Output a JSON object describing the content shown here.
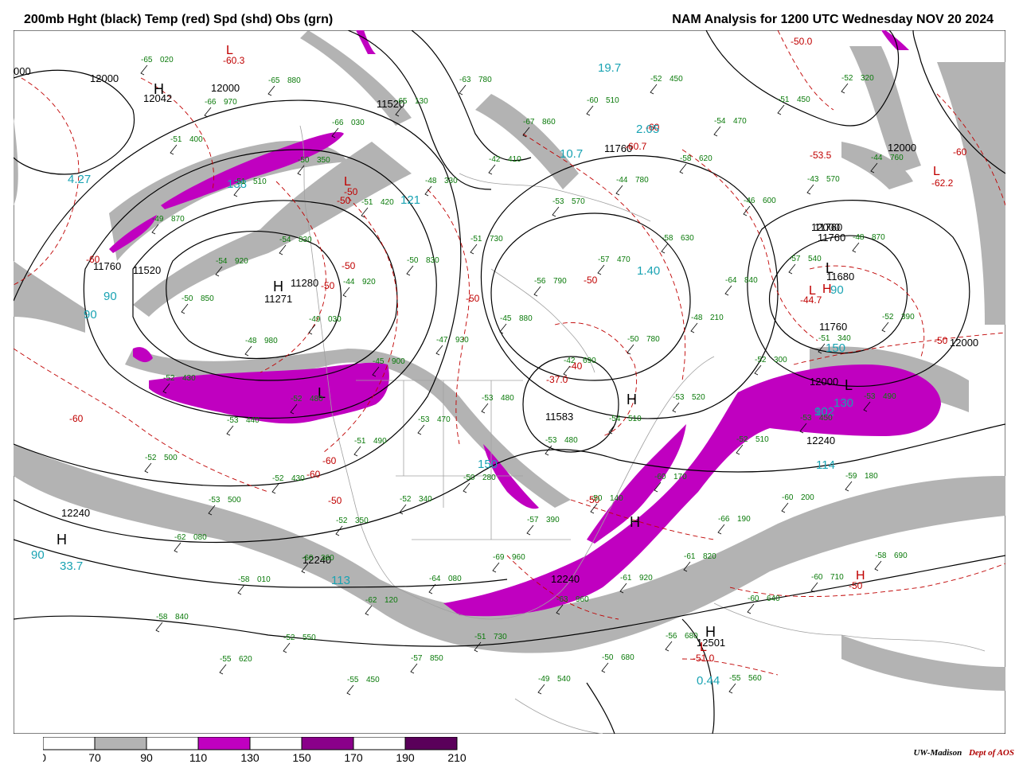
{
  "header": {
    "left_title": "200mb Hght (black) Temp (red) Spd (shd) Obs (grn)",
    "right_title": "NAM Analysis for 1200 UTC Wednesday  NOV 20 2024"
  },
  "colors": {
    "height": "#000000",
    "temp": "#c00000",
    "speed_label": "#19a3b3",
    "obs": "#0a7a0a",
    "geo": "#a0a0a0",
    "shade_70": "#b3b3b3",
    "shade_110": "#c000c0",
    "shade_150": "#8a008a",
    "shade_190": "#5a005a"
  },
  "legend": {
    "ticks": [
      "0",
      "70",
      "90",
      "110",
      "130",
      "150",
      "170",
      "190",
      "210"
    ],
    "colors": [
      "#ffffff",
      "#b3b3b3",
      "#ffffff",
      "#c000c0",
      "#ffffff",
      "#8a008a",
      "#ffffff",
      "#5a005a"
    ]
  },
  "credit": {
    "org": "UW-Madison",
    "dept": "Dept of AOS"
  },
  "height_labels": [
    "000",
    "12000",
    "12042",
    "12000",
    "11520",
    "12000",
    "11760",
    "11520",
    "11280",
    "11271",
    "11760",
    "12000",
    "11760",
    "11680",
    "11760",
    "12000",
    "12000",
    "12240",
    "11583",
    "11760",
    "12240",
    "12240",
    "12240",
    "12501"
  ],
  "height_centers": [
    "H",
    "H",
    "L",
    "L",
    "H",
    "L",
    "H",
    "H",
    "H"
  ],
  "temp_labels": [
    "-60.3",
    "-60",
    "-50",
    "-50",
    "-50",
    "-50",
    "-60.7",
    "-60",
    "-50",
    "-50.0",
    "-50",
    "-62.2",
    "-60",
    "-50",
    "-44.7",
    "-50",
    "-37.0",
    "-40",
    "-60",
    "-60",
    "-50",
    "-50",
    "-51.0",
    "-53.5",
    "-60"
  ],
  "temp_centers": [
    "L",
    "L",
    "L",
    "L",
    "H",
    "L",
    "H"
  ],
  "speed_labels": [
    "19.7",
    "4.27",
    "138",
    "121",
    "90",
    "90",
    "10.7",
    "2.05",
    "1.40",
    "90",
    "150",
    "130",
    "90",
    "114",
    "150",
    "102",
    "90",
    "33.7",
    "113",
    "0.44"
  ],
  "obs_labels": [
    "-65 020",
    "-66 970",
    "-65 880",
    "-66 030",
    "-65 130",
    "-63 780",
    "-67 860",
    "-60 510",
    "-52 450",
    "-54 470",
    "-51 450",
    "-52 320",
    "-51 400",
    "-51 510",
    "-50 350",
    "-51 420",
    "-48 330",
    "-42 410",
    "-53 570",
    "-44 780",
    "-58 620",
    "-46 600",
    "-43 570",
    "-44 760",
    "-49 870",
    "-54 920",
    "-54 830",
    "-44 920",
    "-50 830",
    "-51 730",
    "-56 790",
    "-57 470",
    "-58 630",
    "-64 840",
    "-57 540",
    "-48 870",
    "-50 850",
    "-48 980",
    "-49 030",
    "-45 900",
    "-47 930",
    "-45 880",
    "-42 690",
    "-50 780",
    "-48 210",
    "-52 300",
    "-51 340",
    "-52 390",
    "-52 430",
    "-53 440",
    "-52 480",
    "-51 490",
    "-53 470",
    "-53 480",
    "-53 480",
    "-54 510",
    "-53 520",
    "-52 510",
    "-53 450",
    "-53 490",
    "-52 500",
    "-53 500",
    "-52 430",
    "-52 350",
    "-52 340",
    "-50 280",
    "-57 390",
    "-50 140",
    "-60 170",
    "-66 190",
    "-60 200",
    "-59 180",
    "-62 080",
    "-58 010",
    "-60 360",
    "-62 120",
    "-64 080",
    "-69 960",
    "-63 960",
    "-61 920",
    "-61 820",
    "-60 640",
    "-60 710",
    "-58 690",
    "-58 840",
    "-55 620",
    "-52 550",
    "-55 450",
    "-57 850",
    "-51 730",
    "-49 540",
    "-50 680",
    "-56 680",
    "-55 560"
  ]
}
